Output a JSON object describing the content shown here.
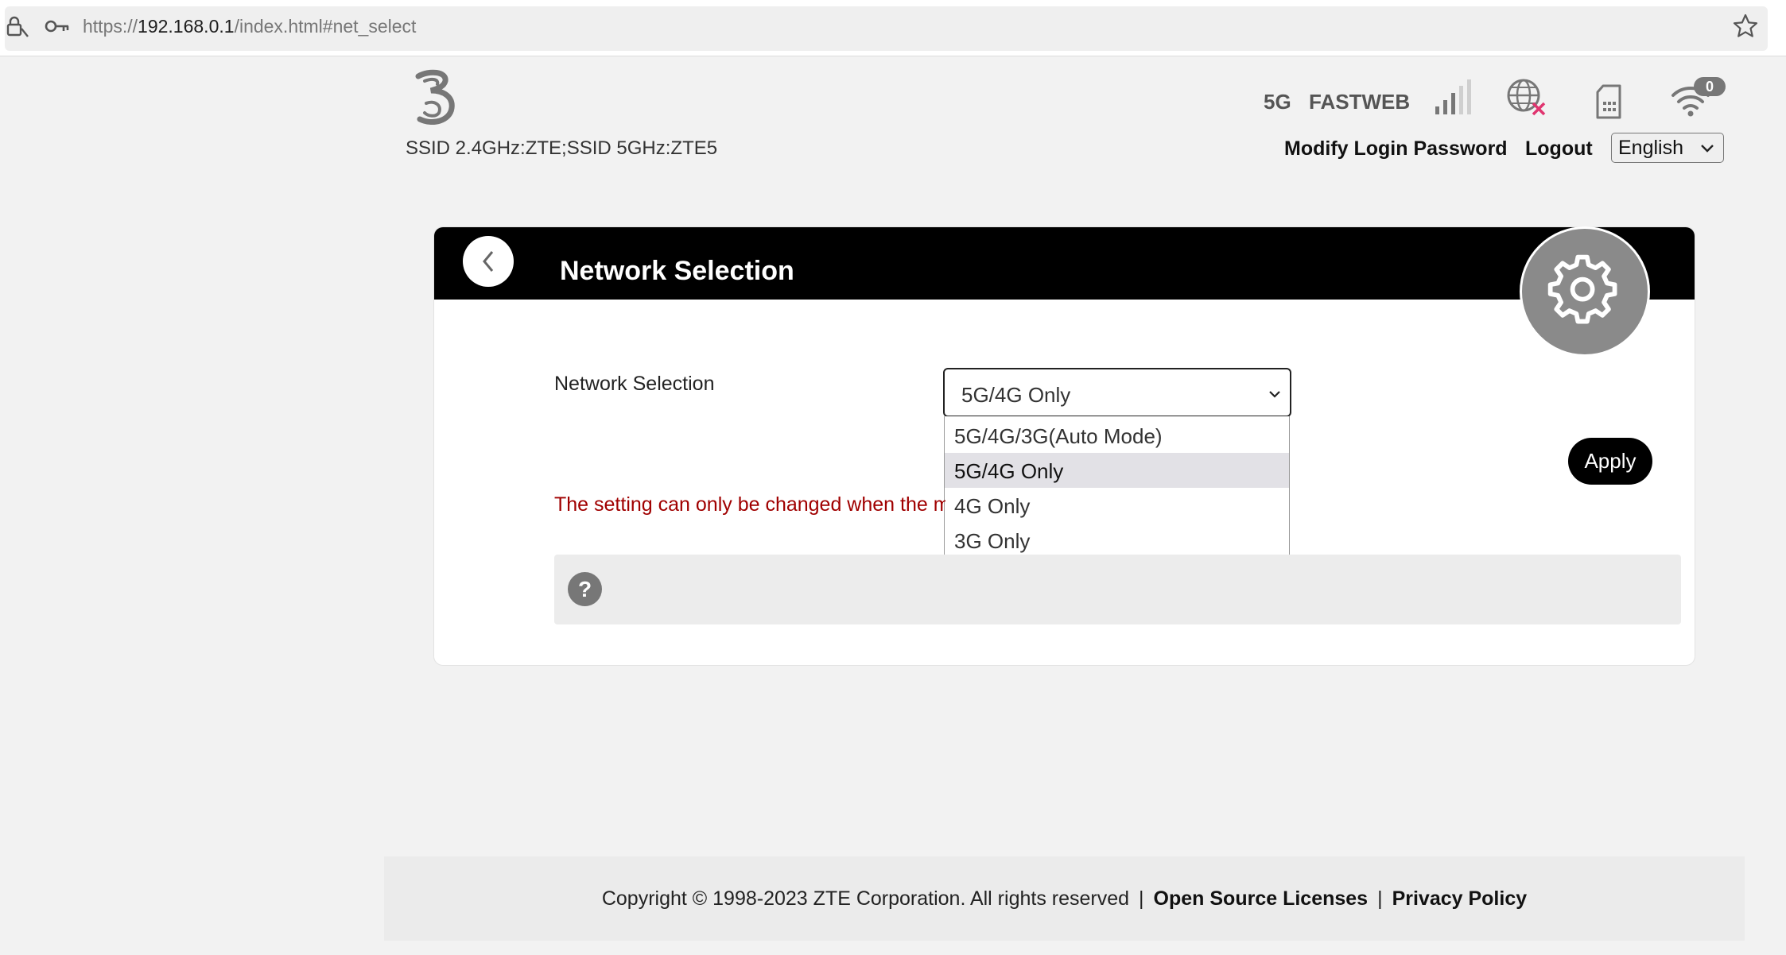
{
  "browser": {
    "url_prefix": "https://",
    "url_host": "192.168.0.1",
    "url_path": "/index.html#net_select"
  },
  "header": {
    "ssid": "SSID 2.4GHz:ZTE;SSID 5GHz:ZTE5",
    "network_type": "5G",
    "operator": "FASTWEB",
    "wifi_clients": "0",
    "modify_password": "Modify Login Password",
    "logout": "Logout",
    "language": "English"
  },
  "page": {
    "title": "Network Selection",
    "field_label": "Network Selection",
    "selected_value": "5G/4G Only",
    "options": [
      {
        "label": "5G/4G/3G(Auto Mode)"
      },
      {
        "label": "5G/4G Only"
      },
      {
        "label": "4G Only"
      },
      {
        "label": "3G Only"
      }
    ],
    "apply": "Apply",
    "warning": "The setting can only be changed when the m",
    "help_symbol": "?"
  },
  "footer": {
    "copyright": "Copyright © 1998-2023 ZTE Corporation. All rights reserved",
    "sep1": "|",
    "open_source": "Open Source Licenses",
    "sep2": "|",
    "privacy": "Privacy Policy"
  },
  "colors": {
    "header_bg": "#000000",
    "warning": "#a00000",
    "gear_bg": "#8a8a8a",
    "selected_option": "#e2e1e6"
  },
  "icons": [
    "lock-icon",
    "key-icon",
    "star-icon",
    "three-logo-icon",
    "signal-icon",
    "globe-disconnected-icon",
    "sim-icon",
    "wifi-icon",
    "back-chevron-icon",
    "gear-icon",
    "help-icon"
  ]
}
